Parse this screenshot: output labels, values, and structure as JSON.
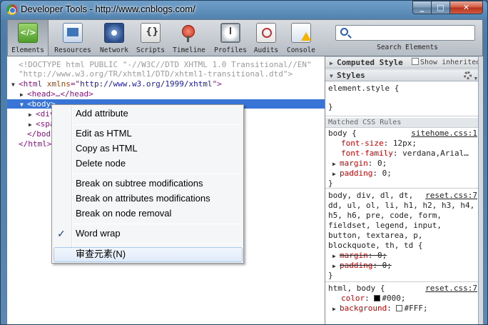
{
  "window": {
    "title": "Developer Tools - http://www.cnblogs.com/"
  },
  "caption": {
    "minimize": "_",
    "maximize": "□",
    "close": "✕"
  },
  "toolbar": {
    "tools": [
      {
        "label": "Elements",
        "icon": "elements-icon",
        "selected": true
      },
      {
        "label": "Resources",
        "icon": "resources-icon"
      },
      {
        "label": "Network",
        "icon": "network-icon"
      },
      {
        "label": "Scripts",
        "icon": "scripts-icon"
      },
      {
        "label": "Timeline",
        "icon": "timeline-icon"
      },
      {
        "label": "Profiles",
        "icon": "profiles-icon"
      },
      {
        "label": "Audits",
        "icon": "audits-icon"
      },
      {
        "label": "Console",
        "icon": "console-icon"
      }
    ],
    "search_value": "",
    "search_caption": "Search Elements"
  },
  "dom": {
    "doctype1": "<!DOCTYPE html PUBLIC \"-//W3C//DTD XHTML 1.0 Transitional//EN\"",
    "doctype2": "\"http://www.w3.org/TR/xhtml1/DTD/xhtml1-transitional.dtd\">",
    "html_open": "<html ",
    "html_attr": "xmlns",
    "html_eq": "=\"",
    "html_val": "http://www.w3.org/1999/xhtml",
    "html_end": "\">",
    "head": "<head>…</head>",
    "body_open": "<body>",
    "div_partial": "<div",
    "span_partial": "<spa",
    "body_close": "</body",
    "html_close": "</html>"
  },
  "styles": {
    "computed_header": "Computed Style",
    "show_inherited": "Show inherited",
    "styles_header": "Styles",
    "element_style_selector": "element.style {",
    "element_style_close": "}",
    "matched_header": "Matched CSS Rules",
    "rule1": {
      "selector": "body {",
      "source": "sitehome.css:1",
      "props": [
        {
          "name": "font-size",
          "value": "12px;"
        },
        {
          "name": "font-family",
          "value": "verdana,Arial…"
        },
        {
          "name": "margin",
          "value": "0;",
          "expand": true
        },
        {
          "name": "padding",
          "value": "0;",
          "expand": true
        }
      ],
      "close": "}"
    },
    "rule2": {
      "source": "reset.css:7",
      "selector_lines": [
        "body, div, dl, dt,",
        "dd, ul, ol, li, h1, h2, h3, h4,",
        "h5, h6, pre, code, form,",
        "fieldset, legend, input,",
        "button, textarea, p,",
        "blockquote, th, td {"
      ],
      "props": [
        {
          "name": "margin",
          "value": "0;"
        },
        {
          "name": "padding",
          "value": "0;"
        }
      ],
      "close": "}"
    },
    "rule3": {
      "selector": "html, body {",
      "source": "reset.css:7",
      "props": [
        {
          "name": "color",
          "value": "#000;",
          "swatch": "#000000"
        },
        {
          "name": "background",
          "value": "#FFF;",
          "swatch": "#FFFFFF"
        }
      ]
    }
  },
  "context_menu": {
    "items": [
      "Add attribute",
      "Edit as HTML",
      "Copy as HTML",
      "Delete node",
      "Break on subtree modifications",
      "Break on attributes modifications",
      "Break on node removal",
      "Word wrap",
      "审查元素(N)"
    ],
    "checked": "✓"
  },
  "colors": {
    "selection": "#3875d7",
    "tag": "#881280",
    "attr_name": "#994500",
    "attr_value": "#1a1aa6"
  }
}
